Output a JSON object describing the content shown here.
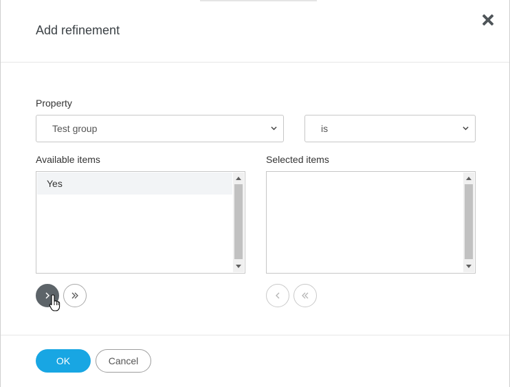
{
  "dialog": {
    "title": "Add refinement",
    "close_icon": "close-icon"
  },
  "property": {
    "label": "Property",
    "value": "Test group",
    "operator": "is"
  },
  "available": {
    "label": "Available items",
    "items": [
      "Yes"
    ]
  },
  "selected": {
    "label": "Selected items",
    "items": []
  },
  "transfer_buttons": {
    "move_right_icon": "chevron-right-icon",
    "move_all_right_icon": "double-chevron-right-icon",
    "move_left_icon": "chevron-left-icon",
    "move_all_left_icon": "double-chevron-left-icon"
  },
  "footer": {
    "ok_label": "OK",
    "cancel_label": "Cancel"
  },
  "colors": {
    "accent": "#18a6e3",
    "active_circle": "#5d6469"
  }
}
